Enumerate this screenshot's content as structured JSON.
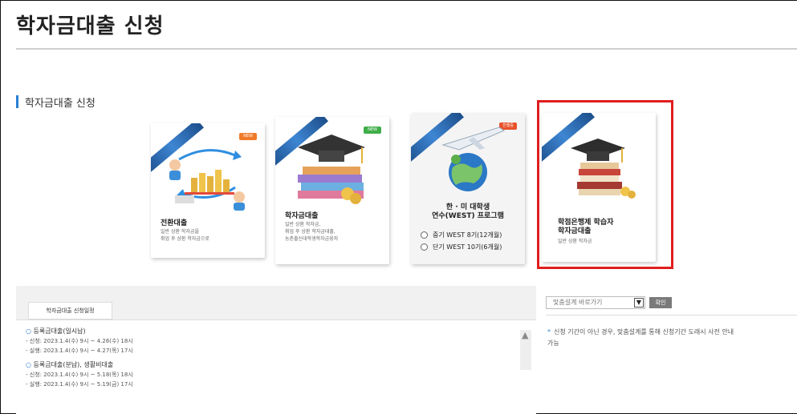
{
  "page": {
    "title": "학자금대출 신청",
    "section_title": "학자금대출 신청"
  },
  "cards": [
    {
      "id": "conversion",
      "badge": "NEW",
      "title": "전환대출",
      "desc": [
        "일반 상환 학자금을",
        "취업 후 상환 학자금으로"
      ]
    },
    {
      "id": "student-loan",
      "badge": "NEW",
      "title": "학자금대출",
      "desc": [
        "일반 상환 학자금,",
        "취업 후 상환 학자금대출,",
        "농촌출신대학생학자금융자"
      ]
    },
    {
      "id": "west",
      "badge": "진행중",
      "title_lines": [
        "한 · 미 대학생",
        "연수(WEST) 프로그램"
      ],
      "options": [
        "중기 WEST 8기(12개월)",
        "단기 WEST 10기(6개월)"
      ]
    },
    {
      "id": "credit-bank",
      "title_lines": [
        "학점은행제 학습자",
        "학자금대출"
      ],
      "desc": [
        "일반 상환 학자금"
      ]
    }
  ],
  "schedule": {
    "tab_label": "학자금대출 신청일정",
    "groups": [
      {
        "heading": "등록금대출(일시납)",
        "lines": [
          "- 신청: 2023.1.4(수) 9시 ~ 4.26(수) 18시",
          "- 실행: 2023.1.4(수) 9시 ~ 4.27(목) 17시"
        ]
      },
      {
        "heading": "등록금대출(분납), 생활비대출",
        "lines": [
          "- 신청: 2023.1.4(수) 9시 ~ 5.18(목) 18시",
          "- 실행: 2023.1.4(수) 9시 ~ 5.19(금) 17시"
        ]
      }
    ]
  },
  "quick": {
    "select_value": "맞춤설계 바로가기",
    "confirm_label": "확인",
    "notice_lines": [
      "신청 기간이 아닌 경우, 맞춤설계를 통해 신청기간 도래시 사전 안내",
      "가능"
    ]
  },
  "colors": {
    "accent": "#2a7fd4",
    "highlight_box": "#e01e1e",
    "ribbon": "#1d4f8c"
  },
  "icons": {
    "scroll_up": "▲",
    "dropdown": "▼"
  }
}
